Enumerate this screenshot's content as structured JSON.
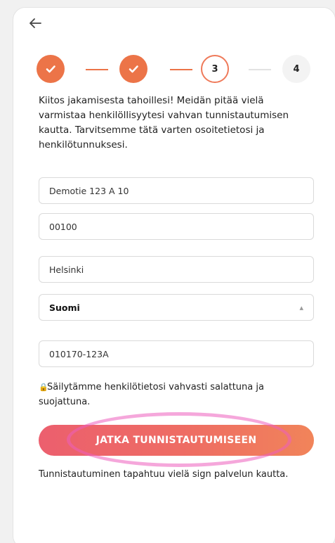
{
  "nav": {
    "back_icon": "arrow-left-icon"
  },
  "stepper": {
    "steps": [
      {
        "label": "",
        "status": "done"
      },
      {
        "label": "",
        "status": "done"
      },
      {
        "label": "3",
        "status": "current"
      },
      {
        "label": "4",
        "status": "pending"
      }
    ],
    "accent": "#ec7448"
  },
  "intro_text": "Kiitos jakamisesta tahoillesi! Meidän pitää vielä varmistaa henkilöllisyytesi vahvan tunnistautumisen kautta. Tarvitsemme tätä varten osoitetietosi ja henkilötunnuksesi.",
  "form": {
    "street": "Demotie 123 A 10",
    "postal_code": "00100",
    "city": "Helsinki",
    "country": "Suomi",
    "ssn": "010170-123A"
  },
  "privacy_text": "Säilytämme henkilötietosi vahvasti salattuna ja suojattuna.",
  "cta": {
    "label": "JATKA TUNNISTAUTUMISEEN",
    "gradient_start": "#ec5f6e",
    "gradient_end": "#f1845a"
  },
  "note_text": "Tunnistautuminen tapahtuu vielä sign palvelun kautta."
}
